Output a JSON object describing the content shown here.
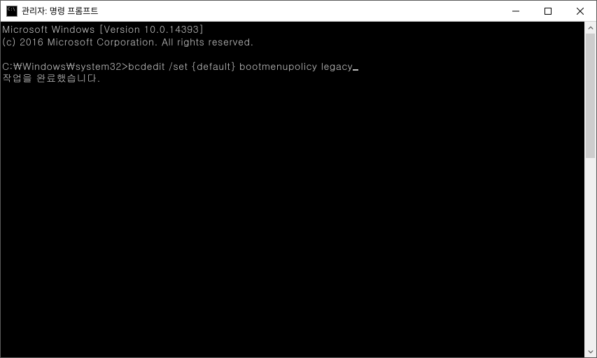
{
  "window": {
    "title": "관리자: 명령 프롬프트"
  },
  "console": {
    "line1": "Microsoft Windows [Version 10.0.14393]",
    "line2": "(c) 2016 Microsoft Corporation. All rights reserved.",
    "blank": "",
    "prompt": "C:\\Windows\\system32>",
    "command": "bcdedit /set {default} bootmenupolicy legacy",
    "result": "작업을 완료했습니다."
  }
}
